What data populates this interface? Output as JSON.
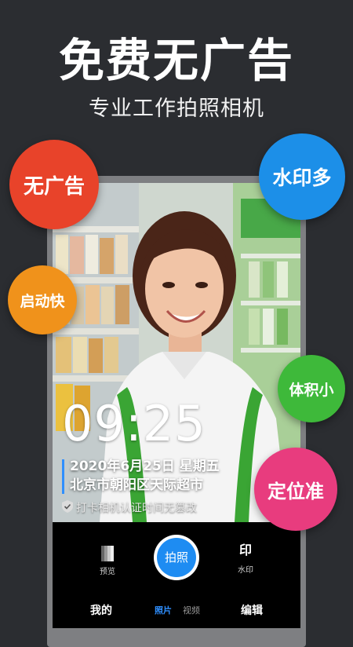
{
  "headline": "免费无广告",
  "subline": "专业工作拍照相机",
  "bubbles": {
    "no_ads": "无广告",
    "watermark": "水印多",
    "fast_start": "启动快",
    "small_size": "体积小",
    "accurate_location": "定位准"
  },
  "camera": {
    "time": "09:25",
    "date_line": "2020年6月25日 星期五",
    "location_line": "北京市朝阳区天际超市",
    "verify_text": "打卡相机认证时间无篡改",
    "preview_label": "预览",
    "shutter_label": "拍照",
    "watermark_icon_text": "印",
    "watermark_label": "水印"
  },
  "tabbar": {
    "mine": "我的",
    "photo": "照片",
    "video": "视频",
    "edit": "编辑"
  },
  "colors": {
    "background": "#2b2d31",
    "bubble_red": "#e8432a",
    "bubble_blue": "#1c8fe8",
    "bubble_orange": "#f0921b",
    "bubble_green": "#3eb93a",
    "bubble_pink": "#e83c7e",
    "accent_blue": "#1e8cf2"
  }
}
